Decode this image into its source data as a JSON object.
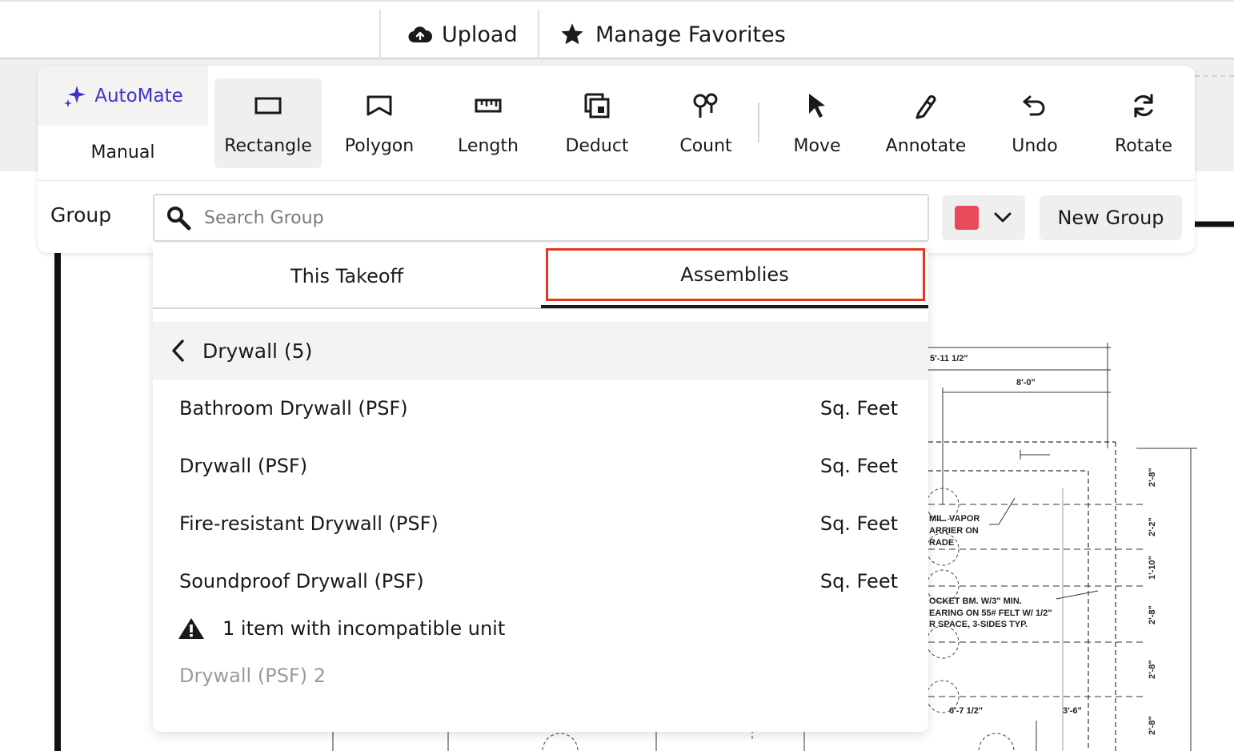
{
  "topbar": {
    "upload_label": "Upload",
    "favorites_label": "Manage Favorites"
  },
  "toolbar": {
    "automate_label": "AutoMate",
    "manual_label": "Manual",
    "tools": [
      {
        "label": "Rectangle",
        "icon": "rectangle-icon",
        "active": true
      },
      {
        "label": "Polygon",
        "icon": "polygon-icon"
      },
      {
        "label": "Length",
        "icon": "ruler-icon"
      },
      {
        "label": "Deduct",
        "icon": "deduct-icon"
      },
      {
        "label": "Count",
        "icon": "count-icon"
      },
      {
        "label": "Move",
        "icon": "cursor-icon"
      },
      {
        "label": "Annotate",
        "icon": "pen-icon"
      },
      {
        "label": "Undo",
        "icon": "undo-icon"
      },
      {
        "label": "Rotate",
        "icon": "rotate-icon"
      }
    ]
  },
  "group": {
    "label": "Group",
    "search_placeholder": "Search Group",
    "color": "#e8495b",
    "new_group_label": "New Group"
  },
  "dropdown": {
    "tabs": [
      {
        "label": "This Takeoff"
      },
      {
        "label": "Assemblies",
        "selected": true
      }
    ],
    "breadcrumb": "Drywall (5)",
    "items": [
      {
        "name": "Bathroom Drywall (PSF)",
        "unit": "Sq. Feet"
      },
      {
        "name": "Drywall (PSF)",
        "unit": "Sq. Feet"
      },
      {
        "name": "Fire-resistant Drywall (PSF)",
        "unit": "Sq. Feet"
      },
      {
        "name": "Soundproof Drywall (PSF)",
        "unit": "Sq. Feet"
      }
    ],
    "warning": "1 item with incompatible unit",
    "incompatible_item": "Drywall (PSF) 2"
  },
  "drawing": {
    "dims": [
      "5'-11 1/2\"",
      "8'-0\"",
      "6'-7 1/2\"",
      "3'-6\"",
      "2'-8\"",
      "2'-2\"",
      "1'-10\"",
      "2'-8\"",
      "2'-8\"",
      "2'-8\""
    ],
    "notes": [
      "MIL. VAPOR",
      "ARRIER ON",
      "RADE",
      "OCKET BM. W/3\" MIN.",
      "EARING ON 55# FELT W/ 1/2\"",
      "R SPACE, 3-SIDES TYP."
    ]
  },
  "accent_highlight_color": "#e5371f"
}
